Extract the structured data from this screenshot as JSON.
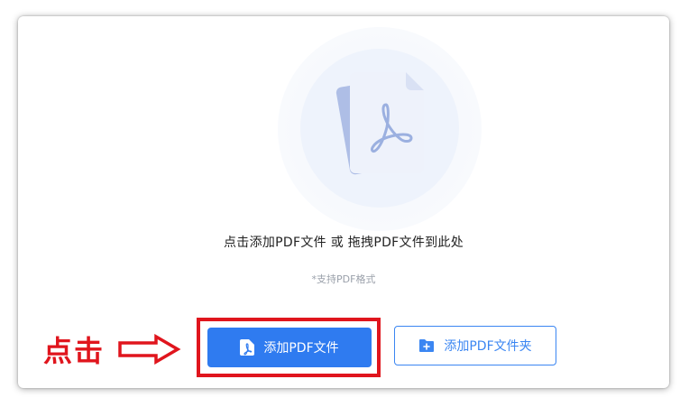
{
  "upload": {
    "hint": "点击添加PDF文件 或 拖拽PDF文件到此处",
    "format_note": "*支持PDF格式"
  },
  "buttons": {
    "add_file_label": "添加PDF文件",
    "add_folder_label": "添加PDF文件夹"
  },
  "annotation": {
    "click_label": "点击"
  },
  "colors": {
    "primary": "#2f7bf0",
    "annotation_red": "#e0151d",
    "doc_back": "#aebee6",
    "doc_front": "#eef2fb",
    "pdf_symbol": "#9bb0e0"
  },
  "icons": {
    "illustration": "pdf-document-stack",
    "add_file_icon": "pdf-file-icon",
    "add_folder_icon": "folder-plus-icon",
    "arrow": "right-arrow-outline"
  }
}
